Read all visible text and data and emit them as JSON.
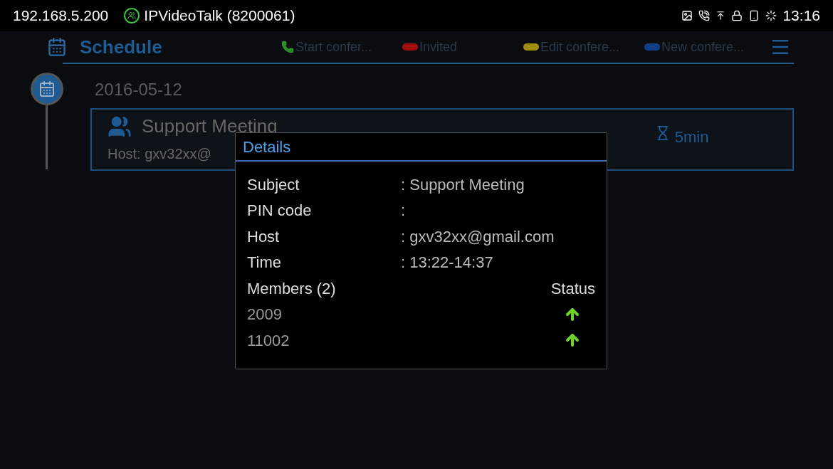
{
  "status_bar": {
    "ip": "192.168.5.200",
    "account": "IPVideoTalk (8200061)",
    "time": "13:16"
  },
  "header": {
    "title": "Schedule",
    "legend": [
      {
        "kind": "phone",
        "label": "Start confer...",
        "color": "#2e8b2e"
      },
      {
        "kind": "dot",
        "label": "Invited",
        "color": "#a01010"
      },
      {
        "kind": "dot",
        "label": "Edit confere...",
        "color": "#a08a10"
      },
      {
        "kind": "dot",
        "label": "New confere...",
        "color": "#123e8a"
      }
    ]
  },
  "schedule": {
    "date": "2016-05-12",
    "meeting": {
      "title": "Support Meeting",
      "host": "Host: gxv32xx@",
      "duration": "5min"
    }
  },
  "dialog": {
    "title": "Details",
    "fields": [
      {
        "label": "Subject",
        "value": ": Support Meeting"
      },
      {
        "label": "PIN code",
        "value": ":"
      },
      {
        "label": "Host",
        "value": ": gxv32xx@gmail.com"
      },
      {
        "label": "Time",
        "value": ": 13:22-14:37"
      }
    ],
    "members_label": "Members (2)",
    "status_label": "Status",
    "members": [
      {
        "name": "2009",
        "online": true
      },
      {
        "name": "11002",
        "online": true
      }
    ]
  }
}
